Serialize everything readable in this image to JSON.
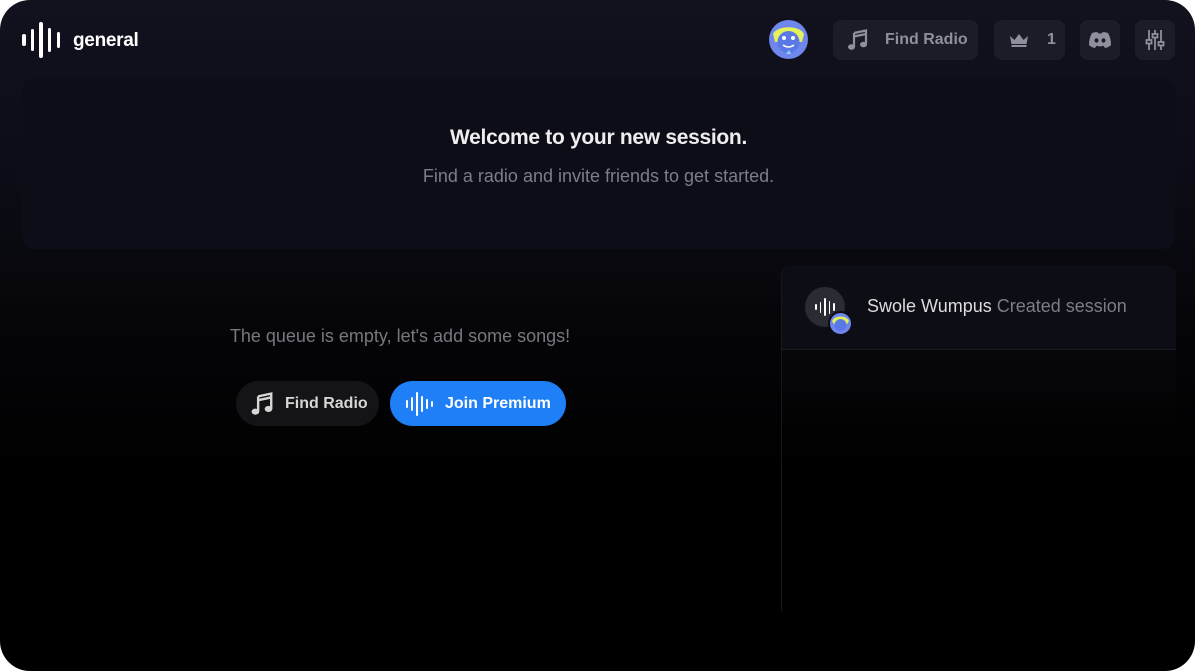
{
  "app": {
    "channel_name": "general"
  },
  "header": {
    "find_radio_label": "Find Radio",
    "listener_count": "1",
    "icons": {
      "logo": "waveform-icon",
      "music": "music-note-icon",
      "crown": "crown-icon",
      "discord": "discord-icon",
      "settings": "sliders-icon"
    }
  },
  "welcome": {
    "title": "Welcome to your new session.",
    "subtitle": "Find a radio and invite friends to get started."
  },
  "queue": {
    "empty_message": "The queue is empty, let's add some songs!",
    "find_radio_label": "Find Radio",
    "premium_label": "Join Premium"
  },
  "activity": {
    "items": [
      {
        "user": "Swole Wumpus",
        "action": "Created session"
      }
    ]
  },
  "colors": {
    "accent": "#1e7ff7",
    "avatar": "#6f86ec",
    "background": "#000000"
  }
}
